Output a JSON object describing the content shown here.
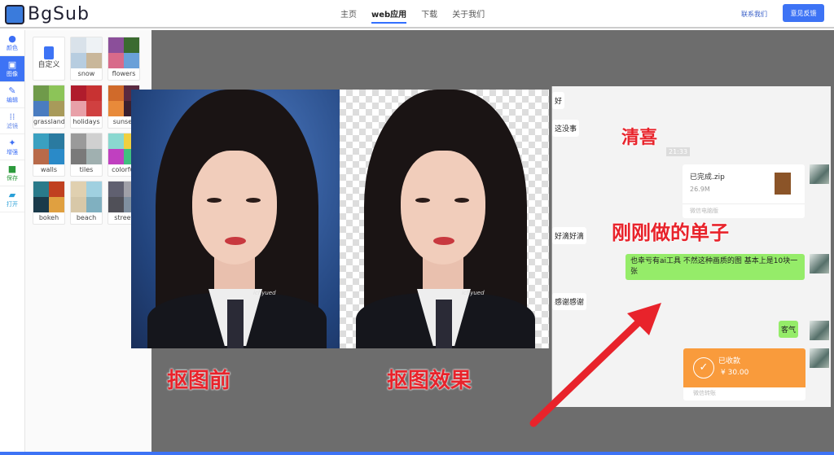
{
  "header": {
    "brand": "BgSub",
    "nav": [
      "主页",
      "web应用",
      "下载",
      "关于我们"
    ],
    "active_nav": "web应用",
    "contact": "联系我们",
    "feedback": "意见反馈",
    "accent": "#3d73f5"
  },
  "rail": [
    {
      "label": "颜色",
      "icon": "palette-icon"
    },
    {
      "label": "图像",
      "icon": "image-icon",
      "active": true
    },
    {
      "label": "编辑",
      "icon": "pencil-icon"
    },
    {
      "label": "滤镜",
      "icon": "filter-icon"
    },
    {
      "label": "增强",
      "icon": "sparkle-icon"
    },
    {
      "label": "保存",
      "icon": "save-icon"
    },
    {
      "label": "打开",
      "icon": "folder-open-icon"
    }
  ],
  "backgrounds": {
    "custom": "自定义",
    "items": [
      "snow",
      "flowers",
      "grassland",
      "holidays",
      "sunset",
      "walls",
      "tiles",
      "colorful",
      "bokeh",
      "beach",
      "street"
    ]
  },
  "photos": {
    "watermark": "ichyued",
    "before_caption": "抠图前",
    "after_caption": "抠图效果"
  },
  "chat": {
    "incoming": [
      "好",
      "这没事",
      "好滴好滴",
      "感谢感谢"
    ],
    "time": "21:33",
    "file": {
      "name": "已完成.zip",
      "size": "26.9M",
      "source": "微信电脑版"
    },
    "outgoing_long": "也幸亏有ai工具 不然这种画质的图 基本上是10块一张",
    "outgoing_short": "客气",
    "payment": {
      "status": "已收款",
      "amount": "¥ 30.00",
      "source": "微信转账"
    },
    "overlay_title": "清喜",
    "overlay_note": "刚刚做的单子"
  }
}
